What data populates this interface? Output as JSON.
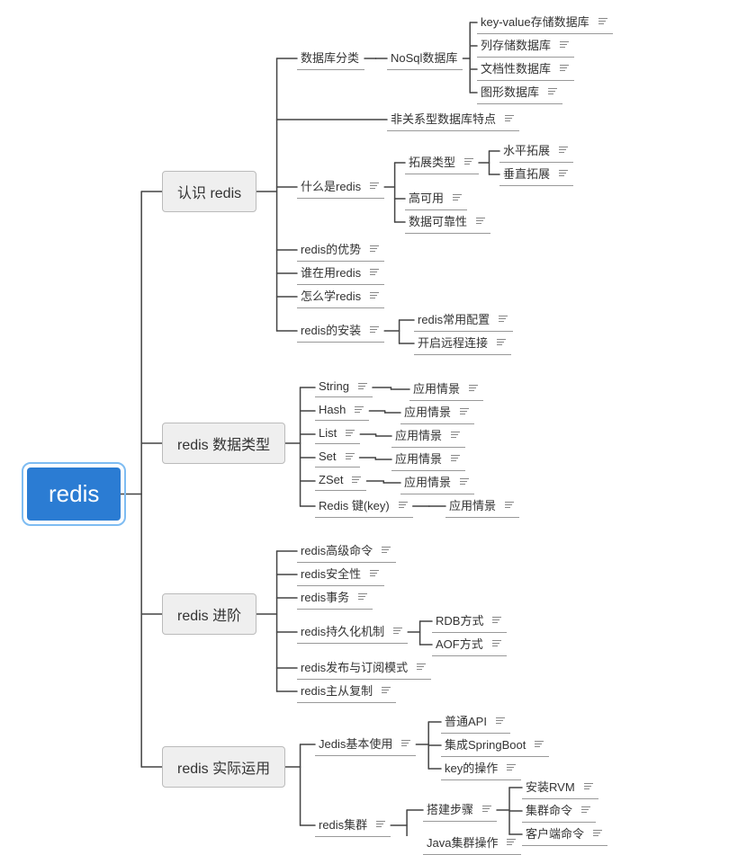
{
  "root": "redis",
  "sections": {
    "s1": "认识 redis",
    "s2": "redis  数据类型",
    "s3": "redis  进阶",
    "s4": "redis  实际运用"
  },
  "leaves": {
    "l_db_cat": "数据库分类",
    "l_nosql": "NoSql数据库",
    "l_kv": "key-value存储数据库",
    "l_col": "列存储数据库",
    "l_doc": "文档性数据库",
    "l_graph": "图形数据库",
    "l_nonrel": "非关系型数据库特点",
    "l_whatis": "什么是redis",
    "l_ext_type": "拓展类型",
    "l_hscale": "水平拓展",
    "l_vscale": "垂直拓展",
    "l_ha": "高可用",
    "l_reliable": "数据可靠性",
    "l_adv": "redis的优势",
    "l_who": "谁在用redis",
    "l_learn": "怎么学redis",
    "l_install": "redis的安装",
    "l_conf": "redis常用配置",
    "l_remote": "开启远程连接",
    "l_string": "String",
    "l_hash": "Hash",
    "l_list": "List",
    "l_set": "Set",
    "l_zset": "ZSet",
    "l_key": "Redis 键(key)",
    "l_scene1": "应用情景",
    "l_scene2": "应用情景",
    "l_scene3": "应用情景",
    "l_scene4": "应用情景",
    "l_scene5": "应用情景",
    "l_scene6": "应用情景",
    "l_advcmd": "redis高级命令",
    "l_sec": "redis安全性",
    "l_tx": "redis事务",
    "l_persist": "redis持久化机制",
    "l_rdb": "RDB方式",
    "l_aof": "AOF方式",
    "l_pubsub": "redis发布与订阅模式",
    "l_ms": "redis主从复制",
    "l_jedis": "Jedis基本使用",
    "l_api": "普通API",
    "l_sb": "集成SpringBoot",
    "l_keyop": "key的操作",
    "l_cluster": "redis集群",
    "l_build": "搭建步骤",
    "l_rvm": "安装RVM",
    "l_ccmd": "集群命令",
    "l_clientcmd": "客户端命令",
    "l_javac": "Java集群操作"
  }
}
